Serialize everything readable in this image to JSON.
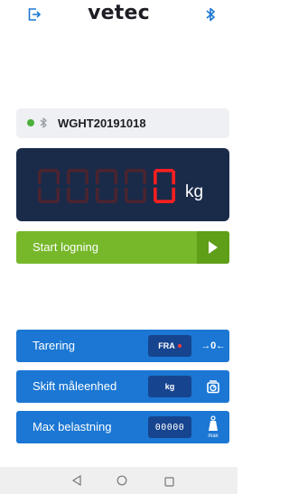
{
  "app": {
    "title": "vetec"
  },
  "icons": {
    "exit": "exit-icon",
    "bluetooth": "bluetooth-icon"
  },
  "device": {
    "name": "WGHT20191018",
    "status_color": "#4caf3a"
  },
  "display": {
    "digits": [
      "0",
      "0",
      "0",
      "0",
      "0"
    ],
    "active_digit_index": 4,
    "unit": "kg",
    "active_color": "#ff1f1f",
    "inactive_color": "#4a2430"
  },
  "start_logging": {
    "label": "Start logning",
    "color": "#76b82a"
  },
  "actions": [
    {
      "label": "Tarering",
      "pill": "FRA",
      "icon": "tare-zero-icon"
    },
    {
      "label": "Skift måleenhed",
      "pill": "kg",
      "icon": "scale-icon"
    },
    {
      "label": "Max belastning",
      "pill": "00000",
      "icon": "max-load-icon"
    }
  ],
  "tare": {
    "zero_label": "→0←"
  },
  "max_icon_label": "max",
  "colors": {
    "accent_blue": "#1b77d3",
    "pill_blue": "#16448f",
    "display_bg": "#1a2b4a"
  }
}
